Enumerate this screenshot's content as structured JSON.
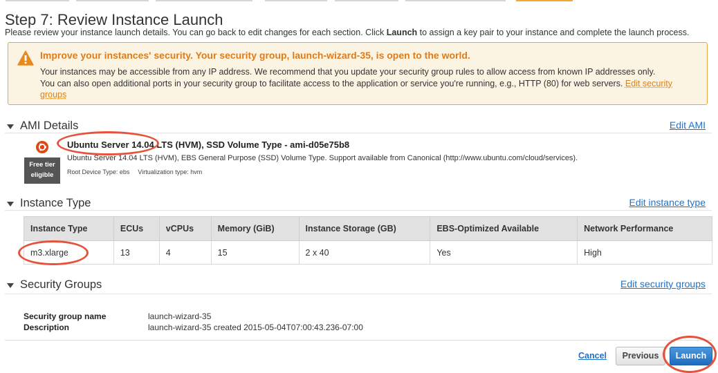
{
  "colors": {
    "accent": "#1f71c7",
    "warning_text": "#e07b17",
    "warning_bg": "#fcf4e2",
    "annotation": "#e6533c",
    "ubuntu": "#dd4814"
  },
  "page": {
    "title": "Step 7: Review Instance Launch",
    "subtitle_pre": "Please review your instance launch details. You can go back to edit changes for each section. Click ",
    "subtitle_bold": "Launch",
    "subtitle_post": " to assign a key pair to your instance and complete the launch process."
  },
  "warning": {
    "icon": "warning-triangle-icon",
    "heading": "Improve your instances' security. Your security group, launch-wizard-35, is open to the world.",
    "line1": "Your instances may be accessible from any IP address. We recommend that you update your security group rules to allow access from known IP addresses only.",
    "line2": "You can also open additional ports in your security group to facilitate access to the application or service you're running, e.g., HTTP (80) for web servers.",
    "link": "Edit security groups"
  },
  "ami": {
    "section_title": "AMI Details",
    "edit_label": "Edit AMI",
    "icon": "ubuntu-logo-icon",
    "badge_line1": "Free tier",
    "badge_line2": "eligible",
    "name": "Ubuntu Server 14.04 LTS (HVM), SSD Volume Type - ami-d05e75b8",
    "description": "Ubuntu Server 14.04 LTS (HVM), EBS General Purpose (SSD) Volume Type. Support available from Canonical (http://www.ubuntu.com/cloud/services).",
    "root_device": "Root Device Type: ebs",
    "virtualization": "Virtualization type: hvm"
  },
  "instance_type": {
    "section_title": "Instance Type",
    "edit_label": "Edit instance type",
    "columns": [
      "Instance Type",
      "ECUs",
      "vCPUs",
      "Memory (GiB)",
      "Instance Storage (GB)",
      "EBS-Optimized Available",
      "Network Performance"
    ],
    "row": [
      "m3.xlarge",
      "13",
      "4",
      "15",
      "2 x 40",
      "Yes",
      "High"
    ]
  },
  "security_groups": {
    "section_title": "Security Groups",
    "edit_label": "Edit security groups",
    "name_label": "Security group name",
    "name_value": "launch-wizard-35",
    "desc_label": "Description",
    "desc_value": "launch-wizard-35 created 2015-05-04T07:00:43.236-07:00"
  },
  "footer": {
    "cancel": "Cancel",
    "previous": "Previous",
    "launch": "Launch"
  }
}
